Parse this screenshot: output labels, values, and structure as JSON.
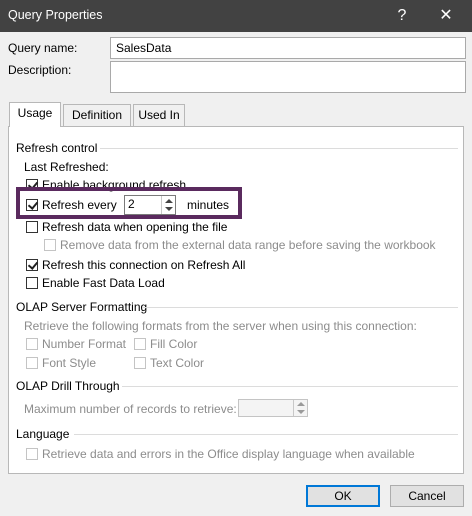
{
  "window": {
    "title": "Query Properties",
    "help_glyph": "?",
    "close_glyph": "✕"
  },
  "fields": {
    "query_name_label": "Query name:",
    "query_name_value": "SalesData",
    "description_label": "Description:",
    "description_value": ""
  },
  "tabs": [
    {
      "label": "Usage",
      "active": true
    },
    {
      "label": "Definition",
      "active": false
    },
    {
      "label": "Used In",
      "active": false
    }
  ],
  "refresh_control": {
    "header": "Refresh control",
    "last_refreshed_label": "Last Refreshed:",
    "enable_background_refresh": {
      "label": "Enable background refresh",
      "checked": true
    },
    "refresh_every": {
      "label": "Refresh every",
      "checked": true,
      "value": "2",
      "unit": "minutes"
    },
    "refresh_on_open": {
      "label": "Refresh data when opening the file",
      "checked": false
    },
    "remove_data": {
      "label": "Remove data from the external data range before saving the workbook",
      "checked": false,
      "disabled": true
    },
    "refresh_on_refresh_all": {
      "label": "Refresh this connection on Refresh All",
      "checked": true
    },
    "fast_data_load": {
      "label": "Enable Fast Data Load",
      "checked": false
    }
  },
  "olap_formatting": {
    "header": "OLAP Server Formatting",
    "description": "Retrieve the following formats from the server when using this connection:",
    "number_format": "Number Format",
    "fill_color": "Fill Color",
    "font_style": "Font Style",
    "text_color": "Text Color"
  },
  "olap_drill": {
    "header": "OLAP Drill Through",
    "max_records_label": "Maximum number of records to retrieve:",
    "max_records_value": ""
  },
  "language": {
    "header": "Language",
    "retrieve_label": "Retrieve data and errors in the Office display language when available"
  },
  "buttons": {
    "ok": "OK",
    "cancel": "Cancel"
  }
}
